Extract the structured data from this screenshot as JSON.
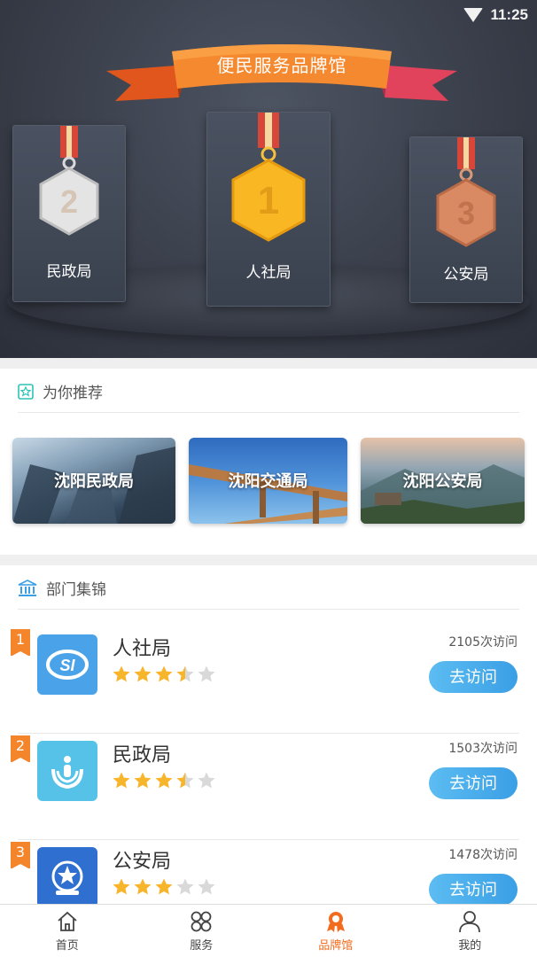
{
  "status_bar": {
    "time": "11:25"
  },
  "hero": {
    "banner_title": "便民服务品牌馆",
    "podiums": [
      {
        "rank": "2",
        "label": "民政局",
        "medal": "silver"
      },
      {
        "rank": "1",
        "label": "人社局",
        "medal": "gold"
      },
      {
        "rank": "3",
        "label": "公安局",
        "medal": "bronze"
      }
    ]
  },
  "recommend": {
    "title": "为你推荐",
    "cards": [
      {
        "label": "沈阳民政局"
      },
      {
        "label": "沈阳交通局"
      },
      {
        "label": "沈阳公安局"
      }
    ]
  },
  "departments": {
    "title": "部门集锦",
    "button_label": "去访问",
    "items": [
      {
        "rank": "1",
        "name": "人社局",
        "visits": "2105次访问",
        "rating": 3.5,
        "icon": "social-security-icon",
        "color": "#4aa3e8"
      },
      {
        "rank": "2",
        "name": "民政局",
        "visits": "1503次访问",
        "rating": 3.5,
        "icon": "civil-affairs-icon",
        "color": "#56c2e8"
      },
      {
        "rank": "3",
        "name": "公安局",
        "visits": "1478次访问",
        "rating": 3,
        "icon": "police-emblem-icon",
        "color": "#2f6fcf"
      }
    ]
  },
  "tabbar": {
    "items": [
      {
        "label": "首页",
        "icon": "home-icon",
        "active": false
      },
      {
        "label": "服务",
        "icon": "services-icon",
        "active": false
      },
      {
        "label": "品牌馆",
        "icon": "brand-hall-icon",
        "active": true
      },
      {
        "label": "我的",
        "icon": "profile-icon",
        "active": false
      }
    ]
  },
  "colors": {
    "accent": "#f36b1c",
    "button": "#3a9fe5",
    "star": "#f7b52c",
    "rank_badge": "#f5852a"
  }
}
